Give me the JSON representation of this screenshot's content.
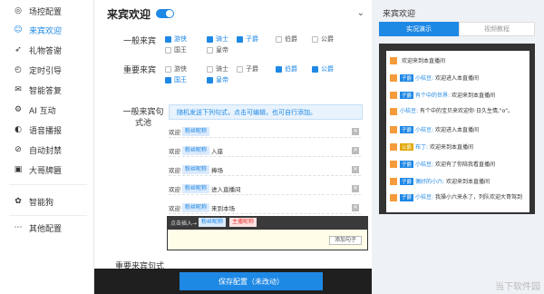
{
  "sidebar": {
    "items": [
      {
        "label": "场控配置",
        "icon": "target-icon"
      },
      {
        "label": "来宾欢迎",
        "icon": "smile-icon"
      },
      {
        "label": "礼物答谢",
        "icon": "rocket-icon"
      },
      {
        "label": "定时引导",
        "icon": "clock-icon"
      },
      {
        "label": "智能答复",
        "icon": "chat-icon"
      },
      {
        "label": "AI 互动",
        "icon": "robot-icon"
      },
      {
        "label": "语音播报",
        "icon": "speaker-icon"
      },
      {
        "label": "自动封禁",
        "icon": "ban-icon"
      },
      {
        "label": "大哥牌匾",
        "icon": "plaque-icon"
      },
      {
        "label": "智能狗",
        "icon": "dog-icon"
      },
      {
        "label": "其他配置",
        "icon": "more-icon"
      }
    ]
  },
  "main": {
    "title": "来宾欢迎",
    "general_label": "一般来宾",
    "important_label": "重要来宾",
    "general_checks": [
      [
        "游侠",
        true
      ],
      [
        "骑士",
        true
      ],
      [
        "子爵",
        true
      ],
      [
        "伯爵",
        false
      ],
      [
        "公爵",
        false
      ],
      [
        "国王",
        false
      ],
      [
        "皇帝",
        false
      ]
    ],
    "important_checks": [
      [
        "游侠",
        false
      ],
      [
        "骑士",
        false
      ],
      [
        "子爵",
        false
      ],
      [
        "伯爵",
        true
      ],
      [
        "公爵",
        true
      ],
      [
        "国王",
        true
      ],
      [
        "皇帝",
        true
      ]
    ],
    "pool_label": "一般来宾句式池",
    "tip": "随机发送下列句式，点击可编辑，也可自行添加。",
    "sentences": [
      [
        "欢迎",
        "粉丝昵称",
        ""
      ],
      [
        "欢迎",
        "粉丝昵称",
        "入座"
      ],
      [
        "欢迎",
        "粉丝昵称",
        "捧场"
      ],
      [
        "欢迎",
        "粉丝昵称",
        "进入直播间"
      ],
      [
        "欢迎",
        "粉丝昵称",
        "来到本场"
      ]
    ],
    "insert_label": "点击插入→",
    "insert_chip1": "粉丝昵称",
    "insert_chip2": "主播昵称",
    "add_button": "添加句子",
    "important_pool_label": "重要来宾句式池",
    "save_button": "保存配置（未改动）"
  },
  "preview": {
    "title": "来宾欢迎",
    "tab_active": "实况演示",
    "tab_inactive": "视频教程",
    "messages": [
      [
        "",
        "",
        "欢迎来到本直播间"
      ],
      [
        "子爵",
        "小桔豆:",
        "欢迎进入本直播间"
      ],
      [
        "子爵",
        "有个中的世界:",
        "欢迎来到本直播间"
      ],
      [
        "",
        "小桔豆:",
        "有个中的宝贝来欢迎你·日久生情,\"o\"。"
      ],
      [
        "子爵",
        "小桔豆:",
        "欢迎进入本直播间"
      ],
      [
        "公爵",
        "布丁:",
        "欢迎来到本直播间"
      ],
      [
        "子爵",
        "小桔豆:",
        "欢迎有了你陪我看直播间"
      ],
      [
        "子爵",
        "偶好的小六:",
        "欢迎来到本直播间"
      ],
      [
        "子爵",
        "小桔豆:",
        "我操小六来永了，列队欢迎大哥驾到"
      ]
    ],
    "watermark": "当下软件园"
  }
}
